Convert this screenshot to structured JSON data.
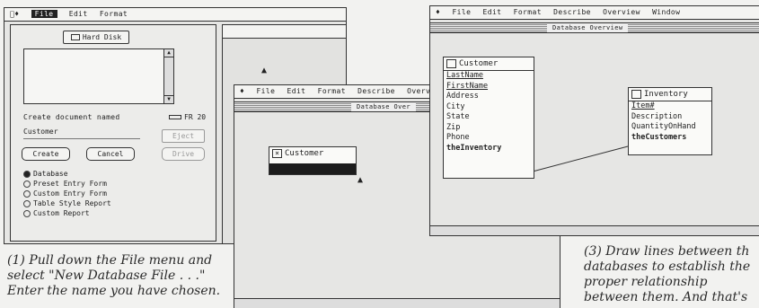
{
  "panel1": {
    "menu": [
      "File",
      "Edit",
      "Format"
    ],
    "disk_button": "Hard Disk",
    "create_label": "Create document named",
    "disk_space": "FR 20",
    "doc_name": "Customer",
    "buttons": {
      "create": "Create",
      "cancel": "Cancel",
      "eject": "Eject",
      "drive": "Drive"
    },
    "options": [
      "Database",
      "Preset Entry Form",
      "Custom Entry Form",
      "Table Style Report",
      "Custom Report"
    ],
    "selected_option": "Database"
  },
  "panel2": {
    "menu": [
      "File",
      "Edit",
      "Format",
      "Describe",
      "Overvi"
    ],
    "window_title": "Database Over",
    "db_name": "Customer"
  },
  "panel3": {
    "menu": [
      "File",
      "Edit",
      "Format",
      "Describe",
      "Overview",
      "Window"
    ],
    "window_title": "Database Overview",
    "customer": {
      "name": "Customer",
      "fields": [
        "LastName",
        "FirstName",
        "Address",
        "City",
        "State",
        "Zip",
        "Phone",
        "theInventory"
      ]
    },
    "inventory": {
      "name": "Inventory",
      "fields": [
        "Item#",
        "Description",
        "QuantityOnHand",
        "theCustomers"
      ]
    }
  },
  "captions": {
    "step1": [
      "(1) Pull down the File menu and",
      "select \"New Database File . . .\"",
      "Enter the name you have chosen."
    ],
    "step3": [
      "(3) Draw lines between th",
      "databases to establish the",
      "proper relationship",
      "between them. And that's"
    ]
  }
}
